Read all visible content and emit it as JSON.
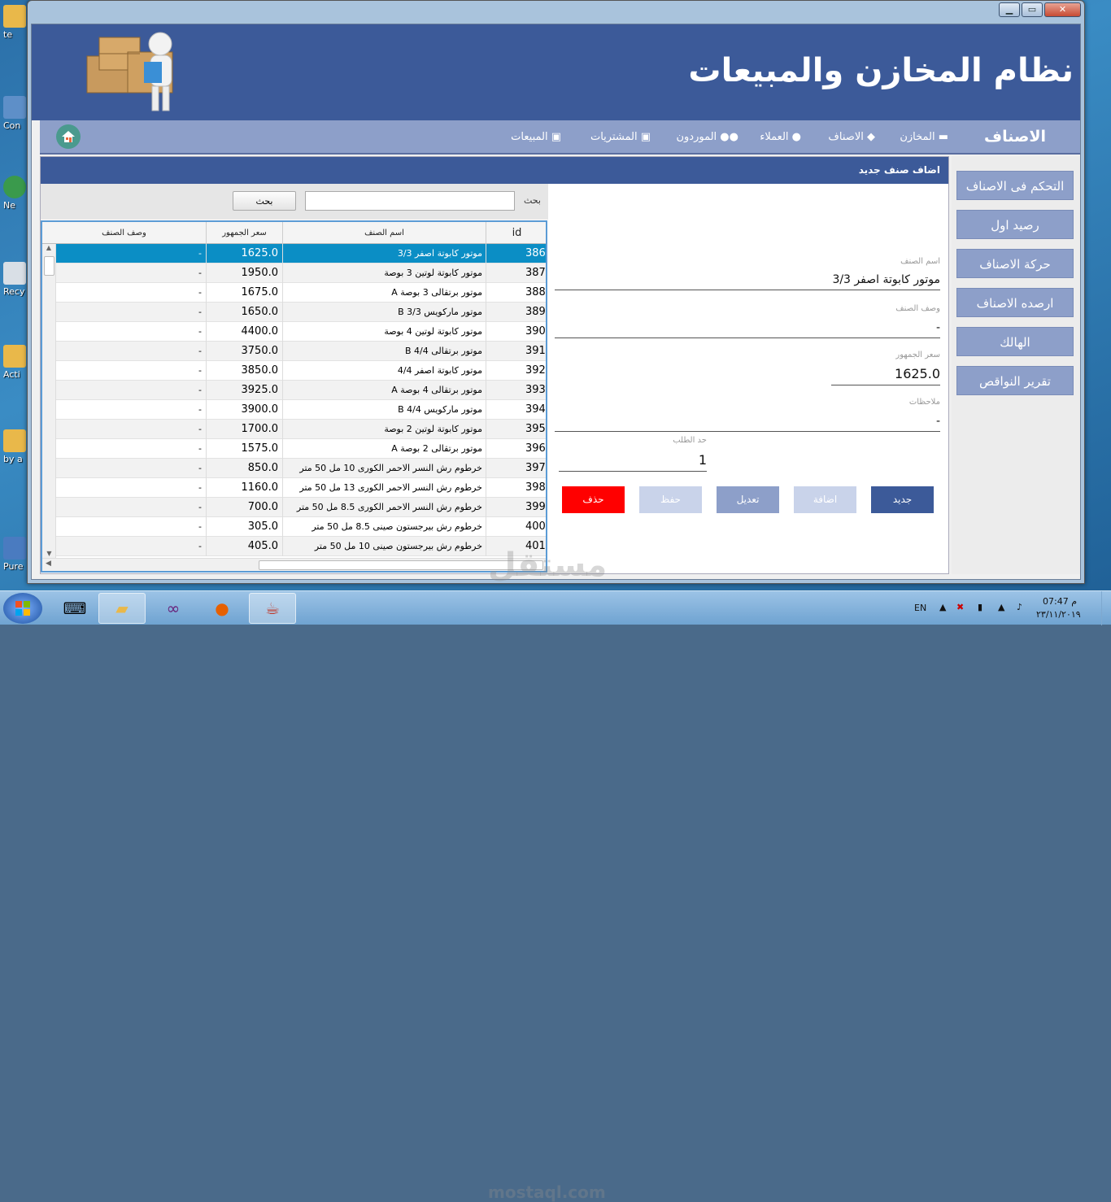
{
  "window": {
    "title": "نظام المخازن والمبيعات",
    "controls": {
      "minimize": "▁",
      "maximize": "▭",
      "close": "✕"
    }
  },
  "nav": {
    "section_title": "الاصناف",
    "items": [
      {
        "label": "المخازن",
        "icon": "store-icon"
      },
      {
        "label": "الاصناف",
        "icon": "tag-icon"
      },
      {
        "label": "العملاء",
        "icon": "user-icon"
      },
      {
        "label": "الموردون",
        "icon": "users-icon"
      },
      {
        "label": "المشتريات",
        "icon": "money-icon"
      },
      {
        "label": "المبيعات",
        "icon": "money-icon"
      }
    ]
  },
  "form_header": "اضاف صنف جديد",
  "search": {
    "label": "بحث",
    "button": "بحث",
    "value": ""
  },
  "table": {
    "columns": [
      "id",
      "اسم الصنف",
      "سعر الجمهور",
      "وصف الصنف"
    ],
    "rows": [
      {
        "id": "386",
        "name": "موتور كابوتة اصفر 3/3",
        "price": "1625.0",
        "desc": "-"
      },
      {
        "id": "387",
        "name": "موتور كابوتة لوتين 3 بوصة",
        "price": "1950.0",
        "desc": "-"
      },
      {
        "id": "388",
        "name": "موتور برتقالى 3 بوصة A",
        "price": "1675.0",
        "desc": "-"
      },
      {
        "id": "389",
        "name": "موتور ماركويس 3/3 B",
        "price": "1650.0",
        "desc": "-"
      },
      {
        "id": "390",
        "name": "موتور كابوتة لوتين 4 بوصة",
        "price": "4400.0",
        "desc": "-"
      },
      {
        "id": "391",
        "name": "موتور برتقالى 4/4 B",
        "price": "3750.0",
        "desc": "-"
      },
      {
        "id": "392",
        "name": "موتور كابوتة اصفر 4/4",
        "price": "3850.0",
        "desc": "-"
      },
      {
        "id": "393",
        "name": "موتور برتقالى 4 بوصة A",
        "price": "3925.0",
        "desc": "-"
      },
      {
        "id": "394",
        "name": "موتور ماركويس 4/4 B",
        "price": "3900.0",
        "desc": "-"
      },
      {
        "id": "395",
        "name": "موتور كابوتة لوتين 2 بوصة",
        "price": "1700.0",
        "desc": "-"
      },
      {
        "id": "396",
        "name": "موتور برتقالى 2 بوصة A",
        "price": "1575.0",
        "desc": "-"
      },
      {
        "id": "397",
        "name": "خرطوم رش النسر الاحمر الكورى 10 مل 50 متر",
        "price": "850.0",
        "desc": "-"
      },
      {
        "id": "398",
        "name": "خرطوم رش النسر الاحمر الكورى 13 مل 50 متر",
        "price": "1160.0",
        "desc": "-"
      },
      {
        "id": "399",
        "name": "خرطوم رش النسر الاحمر الكورى 8.5 مل 50 متر",
        "price": "700.0",
        "desc": "-"
      },
      {
        "id": "400",
        "name": "خرطوم رش بيرجستون صينى 8.5 مل 50 متر",
        "price": "305.0",
        "desc": "-"
      },
      {
        "id": "401",
        "name": "خرطوم رش بيرجستون صينى 10 مل 50 متر",
        "price": "405.0",
        "desc": "-"
      }
    ]
  },
  "form": {
    "name_label": "اسم الصنف",
    "name_value": "موتور كابوتة اصفر 3/3",
    "desc_label": "وصف الصنف",
    "desc_value": "-",
    "price_label": "سعر الجمهور",
    "price_value": "1625.0",
    "notes_label": "ملاحظات",
    "notes_value": "-",
    "limit_label": "حد الطلب",
    "limit_value": "1"
  },
  "actions": {
    "new": "جديد",
    "add": "اضافة",
    "edit": "تعديل",
    "save": "حفظ",
    "delete": "حذف"
  },
  "sidebar": [
    "التحكم فى الاصناف",
    "رصيد اول",
    "حركة الاصناف",
    "ارصده الاصناف",
    "الهالك",
    "تقرير النواقص"
  ],
  "desktop_icons": [
    "te",
    "Con",
    "Ne",
    "Recy",
    "Acti",
    "by a",
    "Pure Pl"
  ],
  "taskbar": {
    "lang": "EN",
    "time": "07:47 م",
    "date": "٢٣/١١/٢٠١٩"
  },
  "watermark": {
    "main": "مستقل",
    "sub": "mostaql.com"
  },
  "colors": {
    "header": "#3c5a99",
    "nav": "#8d9fc9",
    "selected_row": "#0b8ec5",
    "delete": "#ff0000"
  }
}
